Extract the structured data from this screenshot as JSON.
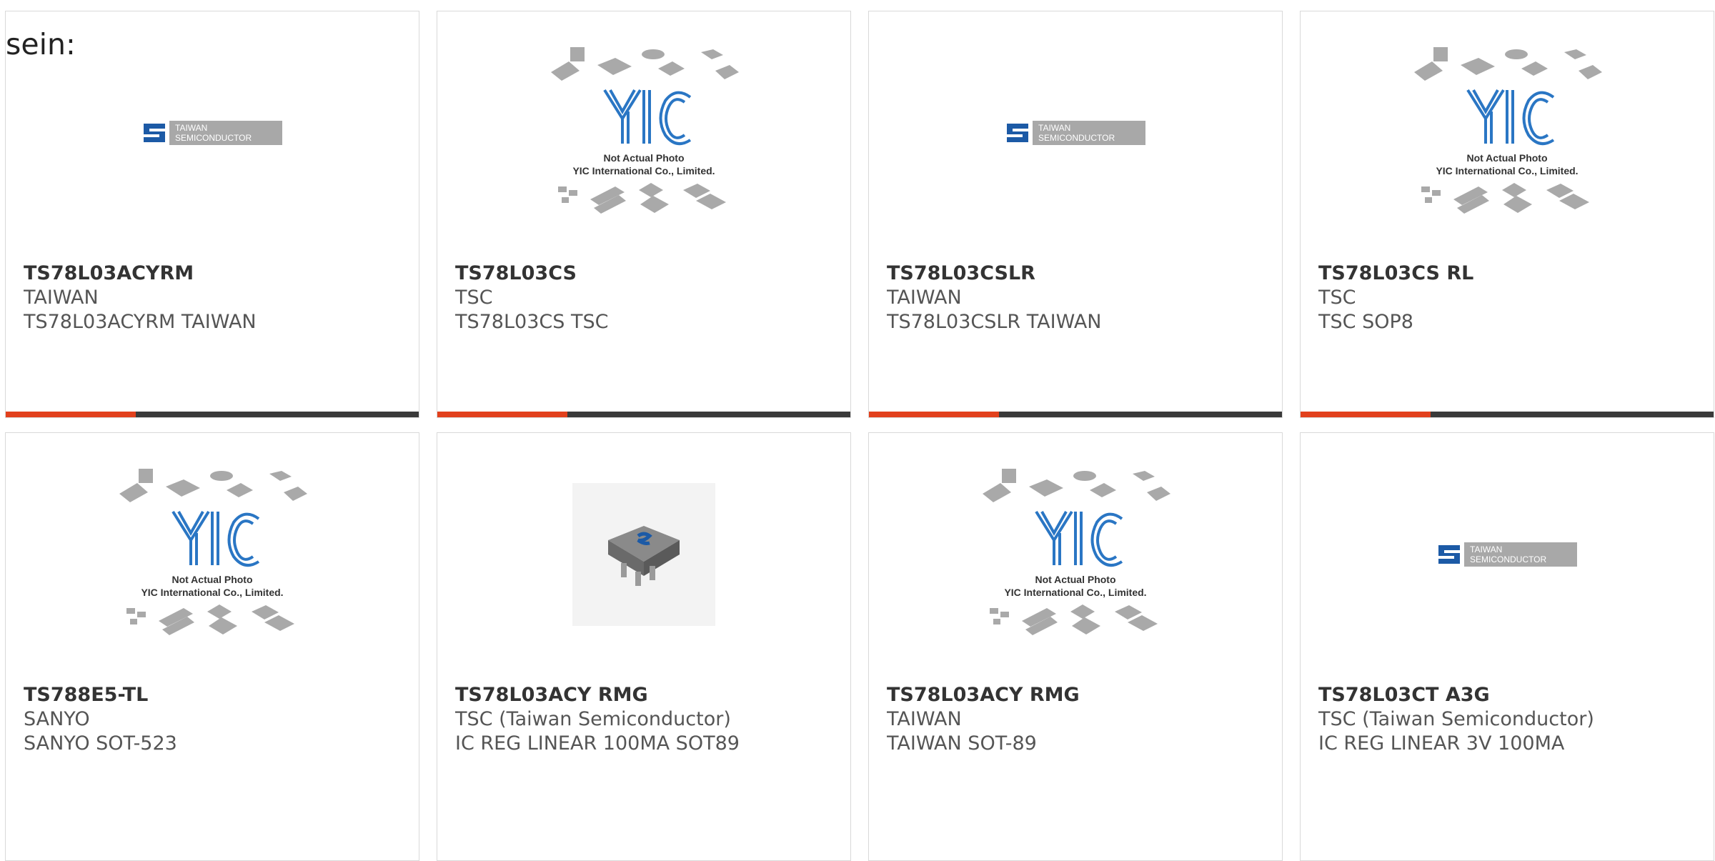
{
  "lead_text": "sein:",
  "products": [
    {
      "name": "TS78L03ACYRM",
      "maker": "TAIWAN",
      "desc": "TS78L03ACYRM TAIWAN",
      "image": "tsc-logo"
    },
    {
      "name": "TS78L03CS",
      "maker": "TSC",
      "desc": "TS78L03CS TSC",
      "image": "yic-placeholder"
    },
    {
      "name": "TS78L03CSLR",
      "maker": "TAIWAN",
      "desc": "TS78L03CSLR TAIWAN",
      "image": "tsc-logo"
    },
    {
      "name": "TS78L03CS RL",
      "maker": "TSC",
      "desc": "TSC SOP8",
      "image": "yic-placeholder"
    },
    {
      "name": "TS788E5-TL",
      "maker": "SANYO",
      "desc": "SANYO SOT-523",
      "image": "yic-placeholder"
    },
    {
      "name": "TS78L03ACY RMG",
      "maker": "TSC (Taiwan Semiconductor)",
      "desc": "IC REG LINEAR 100MA SOT89",
      "image": "sot89-chip"
    },
    {
      "name": "TS78L03ACY RMG",
      "maker": "TAIWAN",
      "desc": "TAIWAN SOT-89",
      "image": "yic-placeholder"
    },
    {
      "name": "TS78L03CT A3G",
      "maker": "TSC (Taiwan Semiconductor)",
      "desc": "IC REG LINEAR 3V 100MA",
      "image": "tsc-logo"
    }
  ],
  "logo_text": {
    "tsc_line1": "TAIWAN",
    "tsc_line2": "SEMICONDUCTOR",
    "yic_line1": "Not Actual Photo",
    "yic_line2": "YIC International Co., Limited."
  },
  "colors": {
    "accent": "#e2401c",
    "bar": "#3a3a3a",
    "tsc_blue": "#1c5aa6",
    "yic_blue": "#2a76c4"
  }
}
